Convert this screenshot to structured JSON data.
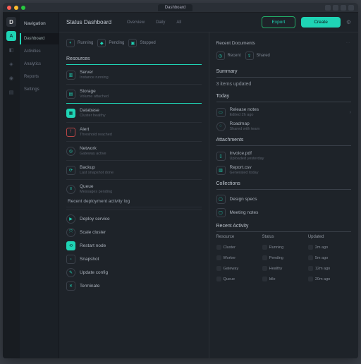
{
  "window": {
    "tab": "Dashboard"
  },
  "rail": {
    "logo": "D",
    "active": "A"
  },
  "sidebar": {
    "title": "Navigation",
    "items": [
      {
        "label": "Dashboard"
      },
      {
        "label": "Activities"
      },
      {
        "label": "Analytics"
      },
      {
        "label": "Reports"
      },
      {
        "label": "Settings"
      }
    ]
  },
  "topbar": {
    "title": "Status Dashboard",
    "pills": [
      "Overview",
      "Daily",
      "All"
    ],
    "ghost": "Export",
    "cta": "Create"
  },
  "left": {
    "chips": [
      {
        "label": "Running"
      },
      {
        "label": "Pending"
      },
      {
        "label": "Stopped"
      }
    ],
    "section1": "Resources",
    "rows1": [
      {
        "t1": "Server",
        "t2": "Instance running"
      },
      {
        "t1": "Storage",
        "t2": "Volume attached"
      },
      {
        "t1": "Database",
        "t2": "Cluster healthy"
      },
      {
        "t1": "Alert",
        "t2": "Threshold reached"
      },
      {
        "t1": "Network",
        "t2": "Gateway active"
      },
      {
        "t1": "Backup",
        "t2": "Last snapshot done"
      },
      {
        "t1": "Queue",
        "t2": "Messages pending"
      }
    ],
    "footer_line": "Recent deployment activity log",
    "section2_rows": [
      {
        "t1": "Deploy service"
      },
      {
        "t1": "Scale cluster"
      },
      {
        "t1": "Restart node"
      },
      {
        "t1": "Snapshot"
      },
      {
        "t1": "Update config"
      },
      {
        "t1": "Terminate"
      }
    ]
  },
  "right": {
    "head": "Recent Documents",
    "chips": [
      {
        "label": "Recent"
      },
      {
        "label": "Shared"
      }
    ],
    "groupA": {
      "title": "Summary",
      "line": "3 items updated"
    },
    "groupB": {
      "title": "Today"
    },
    "rowsB": [
      {
        "t1": "Release notes",
        "t2": "Edited 2h ago"
      },
      {
        "t1": "Roadmap",
        "t2": "Shared with team"
      }
    ],
    "groupC": {
      "title": "Attachments"
    },
    "rowsC": [
      {
        "t1": "Invoice.pdf",
        "t2": "Uploaded yesterday"
      },
      {
        "t1": "Report.csv",
        "t2": "Generated today"
      }
    ],
    "groupD": {
      "title": "Collections"
    },
    "rowsD": [
      {
        "t1": "Design specs"
      },
      {
        "t1": "Meeting notes"
      }
    ],
    "table": {
      "title": "Recent Activity",
      "headers": [
        "Resource",
        "Status",
        "Updated"
      ],
      "rows": [
        [
          "Cluster",
          "Running",
          "2m ago"
        ],
        [
          "Worker",
          "Pending",
          "5m ago"
        ],
        [
          "Gateway",
          "Healthy",
          "12m ago"
        ],
        [
          "Queue",
          "Idle",
          "20m ago"
        ]
      ]
    }
  }
}
